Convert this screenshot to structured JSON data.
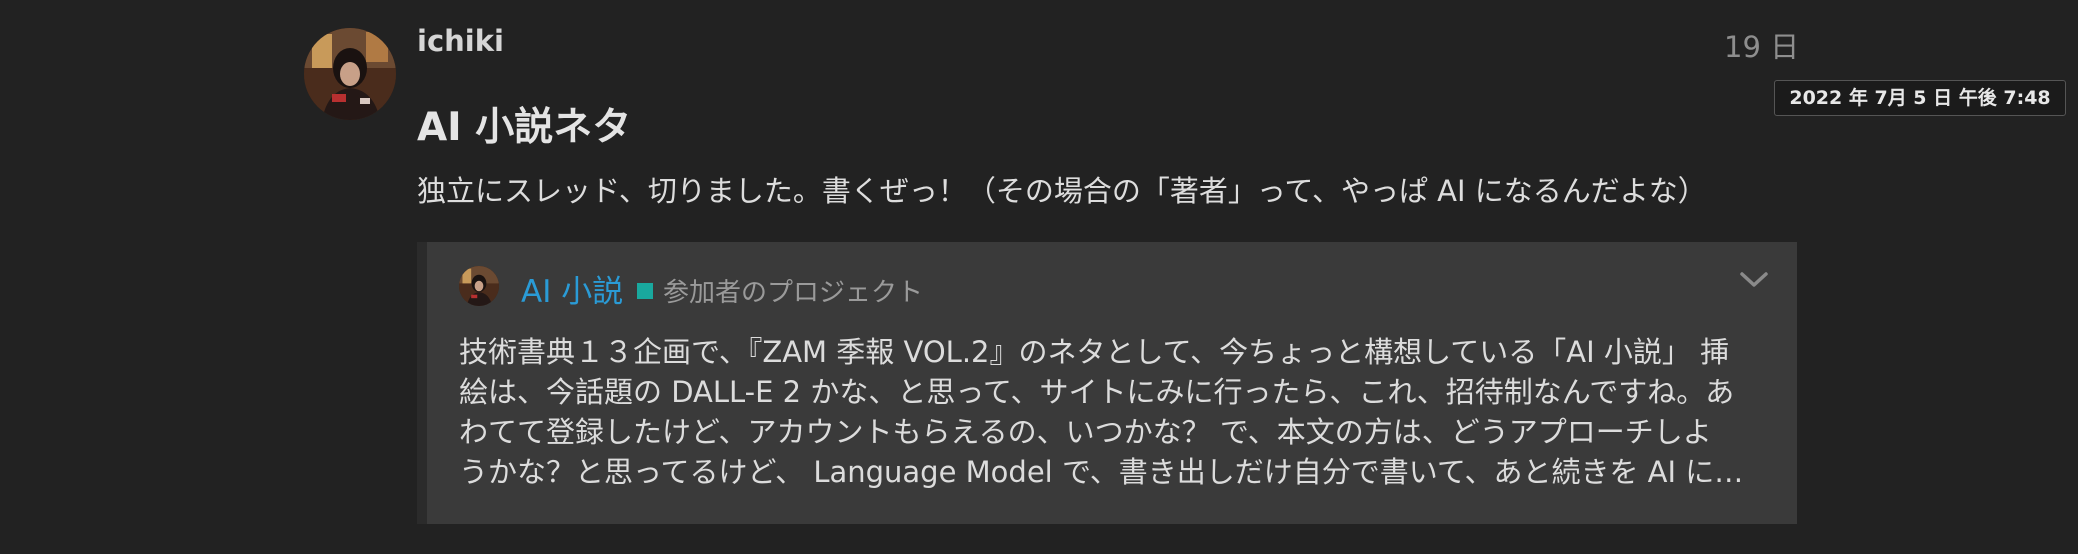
{
  "post": {
    "username": "ichiki",
    "relative_date": "19 日",
    "date_tooltip": "2022 年 7月 5 日 午後 7:48",
    "title": "AI 小説ネタ",
    "body": "独立にスレッド、切りました。書くぜっ！（その場合の「著者」って、やっぱ AI になるんだよな）"
  },
  "onebox": {
    "title": "AI 小説",
    "category": "参加者のプロジェクト",
    "category_color": "#19a89e",
    "link_color": "#2a9bd6",
    "excerpt_lines": [
      "技術書典１３企画で、『ZAM 季報 VOL.2』のネタとして、今ちょっと構想している「AI 小説」 挿",
      "絵は、今話題の DALL-E 2 かな、と思って、サイトにみに行ったら、これ、招待制なんですね。あ",
      "わてて登録したけど、アカウントもらえるの、いつかな？ で、本文の方は、どうアプローチしよ",
      "うかな？と思ってるけど、 Language Model で、書き出しだけ自分で書いて、あと続きを AI に…"
    ]
  },
  "icons": {
    "avatar": "user-avatar-photo",
    "expand": "chevron-down-icon"
  }
}
